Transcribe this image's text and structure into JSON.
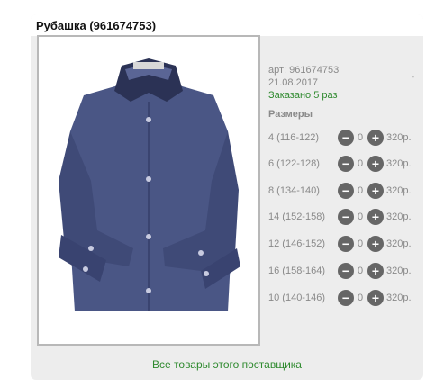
{
  "product": {
    "title": "Рубашка (961674753)",
    "art": "арт: 961674753",
    "date": "21.08.2017",
    "ordered": "Заказано 5 раз",
    "tick_mark": "'"
  },
  "sizes": {
    "title": "Размеры",
    "rows": [
      {
        "label": "4 (116-122)",
        "qty": "0",
        "price": "320р."
      },
      {
        "label": "6 (122-128)",
        "qty": "0",
        "price": "320р."
      },
      {
        "label": "8 (134-140)",
        "qty": "0",
        "price": "320р."
      },
      {
        "label": "14 (152-158)",
        "qty": "0",
        "price": "320р."
      },
      {
        "label": "12 (146-152)",
        "qty": "0",
        "price": "320р."
      },
      {
        "label": "16 (158-164)",
        "qty": "0",
        "price": "320р."
      },
      {
        "label": "10 (140-146)",
        "qty": "0",
        "price": "320р."
      }
    ],
    "minus_symbol": "−",
    "plus_symbol": "+"
  },
  "supplier_link": "Все товары этого поставщика",
  "colors": {
    "accent_green": "#2f8a2f",
    "shirt": "#4a5685"
  }
}
